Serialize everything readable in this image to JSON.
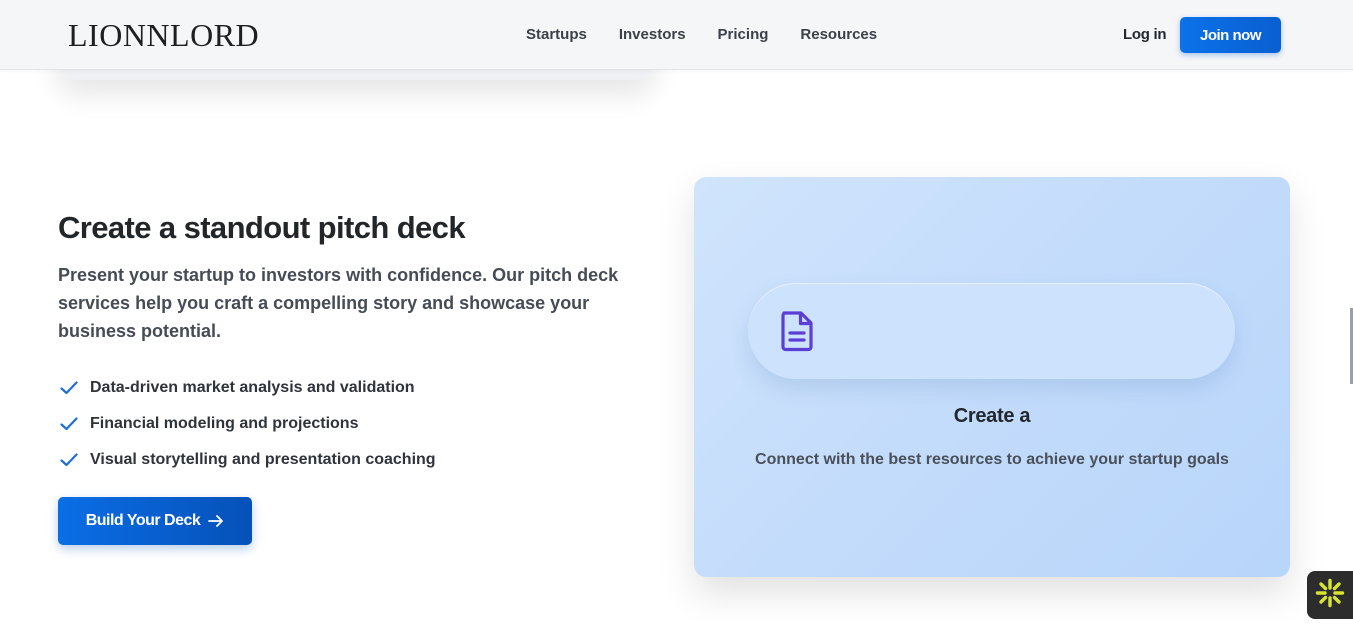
{
  "header": {
    "logo": "LIONNLORD",
    "nav": [
      "Startups",
      "Investors",
      "Pricing",
      "Resources"
    ],
    "login_label": "Log in",
    "join_label": "Join now"
  },
  "section": {
    "title": "Create a standout pitch deck",
    "description": "Present your startup to investors with confidence. Our pitch deck services help you craft a compelling story and showcase your business potential.",
    "features": [
      "Data-driven market analysis and validation",
      "Financial modeling and projections",
      "Visual storytelling and presentation coaching"
    ],
    "cta_label": "Build Your Deck",
    "cta_icon": "arrow-right-icon"
  },
  "panel": {
    "icon": "document-icon",
    "title": "Create a",
    "subtitle": "Connect with the best resources to achieve your startup goals"
  },
  "widget": {
    "icon": "sparkle-icon"
  },
  "colors": {
    "primary": "#0a6ee6",
    "primary_dark": "#0651b8",
    "check": "#1f6fd6",
    "doc_icon": "#5b3fd4",
    "panel_bg": "#c8dffb",
    "widget_bg": "#2c2c2c",
    "widget_icon": "#d7e52f"
  }
}
